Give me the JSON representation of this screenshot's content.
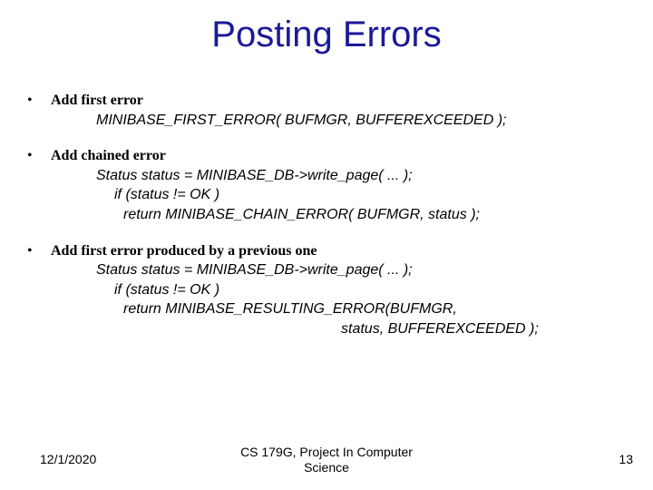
{
  "title": "Posting Errors",
  "bullets": [
    {
      "heading": "Add first error",
      "lines": [
        {
          "cls": "code",
          "text": "MINIBASE_FIRST_ERROR( BUFMGR, BUFFEREXCEEDED );"
        }
      ]
    },
    {
      "heading": "Add chained error",
      "lines": [
        {
          "cls": "code",
          "text": "Status status = MINIBASE_DB->write_page( ... );"
        },
        {
          "cls": "code code-indent1",
          "text": "if (status != OK )"
        },
        {
          "cls": "code code-indent2",
          "text": "return MINIBASE_CHAIN_ERROR( BUFMGR, status );"
        }
      ]
    },
    {
      "heading": "Add first error produced by a previous one",
      "lines": [
        {
          "cls": "code",
          "text": "Status status = MINIBASE_DB->write_page( ... );"
        },
        {
          "cls": "code code-indent1",
          "text": "if (status != OK )"
        },
        {
          "cls": "code code-indent2",
          "text": "return MINIBASE_RESULTING_ERROR(BUFMGR,"
        },
        {
          "cls": "code code-indent-ret",
          "text": "status, BUFFEREXCEEDED );"
        }
      ]
    }
  ],
  "footer": {
    "date": "12/1/2020",
    "center_line1": "CS 179G, Project In Computer",
    "center_line2": "Science",
    "page": "13"
  }
}
